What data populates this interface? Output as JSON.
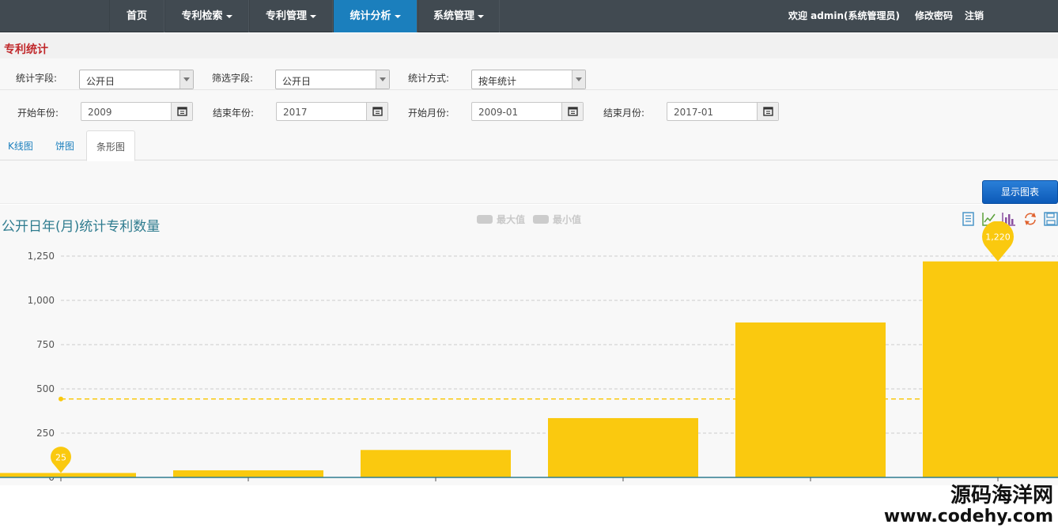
{
  "nav": {
    "items": [
      {
        "label": "首页",
        "dropdown": false
      },
      {
        "label": "专利检索",
        "dropdown": true
      },
      {
        "label": "专利管理",
        "dropdown": true
      },
      {
        "label": "统计分析",
        "dropdown": true,
        "active": true
      },
      {
        "label": "系统管理",
        "dropdown": true
      }
    ],
    "welcome": "欢迎 admin(系统管理员)",
    "change_password": "修改密码",
    "logout": "注销"
  },
  "section_title": "专利统计",
  "form": {
    "stat_field_label": "统计字段:",
    "stat_field_value": "公开日",
    "filter_field_label": "筛选字段:",
    "filter_field_value": "公开日",
    "stat_method_label": "统计方式:",
    "stat_method_value": "按年统计",
    "start_year_label": "开始年份:",
    "start_year_value": "2009",
    "end_year_label": "结束年份:",
    "end_year_value": "2017",
    "start_month_label": "开始月份:",
    "start_month_value": "2009-01",
    "end_month_label": "结束月份:",
    "end_month_value": "2017-01"
  },
  "tabs": [
    {
      "label": "K线图",
      "active": false
    },
    {
      "label": "饼图",
      "active": false
    },
    {
      "label": "条形图",
      "active": true
    }
  ],
  "show_chart_button": "显示图表",
  "colors": {
    "nav_bg": "#414a51",
    "nav_active": "#1b7fbd",
    "bar": "#fac90f",
    "title": "#2f7c8f",
    "section_title": "#c0282b"
  },
  "chart_data": {
    "type": "bar",
    "title": "公开日年(月)统计专利数量",
    "legend": [
      {
        "name": "最大值"
      },
      {
        "name": "最小值"
      }
    ],
    "legend_placement": "top-center",
    "toolbox": [
      "data-view-icon",
      "line-chart-icon",
      "bar-chart-icon",
      "restore-icon",
      "save-icon"
    ],
    "values": [
      25,
      40,
      155,
      335,
      875,
      1220
    ],
    "ylim": [
      0,
      1250
    ],
    "yticks": [
      0,
      250,
      500,
      750,
      1000,
      1250
    ],
    "ytick_labels": [
      "0",
      "250",
      "500",
      "750",
      "1,000",
      "1,250"
    ],
    "average": 443,
    "markpoints": {
      "max": {
        "label": "1,220",
        "index": 5
      },
      "min": {
        "label": "25",
        "index": 0
      }
    },
    "grid": true
  },
  "watermark": {
    "line1": "源码海洋网",
    "line2": "www.codehy.com"
  }
}
